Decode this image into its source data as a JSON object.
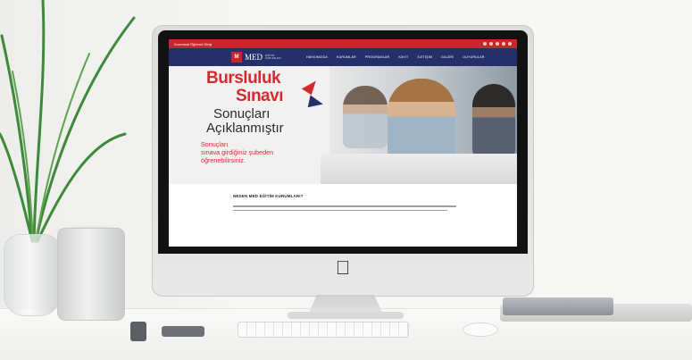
{
  "colors": {
    "brand_red": "#d52a2f",
    "brand_navy": "#25306b"
  },
  "topbar": {
    "left_text": "Kurumsal  Öğrenci Girişi"
  },
  "nav": {
    "brand_mark": "M",
    "brand_name": "MED",
    "brand_sub": "EĞİTİM KURUMLARI",
    "items": [
      "HAKKIMIZDA",
      "KURUMLAR",
      "PROGRAMLAR",
      "KAYIT",
      "İLETİŞİM",
      "GALERİ",
      "DUYURULAR"
    ]
  },
  "hero": {
    "title_line1": "Bursluluk",
    "title_line2": "Sınavı",
    "subtitle_line1": "Sonuçları",
    "subtitle_line2": "Açıklanmıştır",
    "note_line1": "Sonuçları",
    "note_line2": "sınava girdiğiniz şubeden",
    "note_line3": "öğrenebilirsiniz."
  },
  "content": {
    "section_title": "NEDEN MED EĞİTİM KURUMLARI?"
  }
}
